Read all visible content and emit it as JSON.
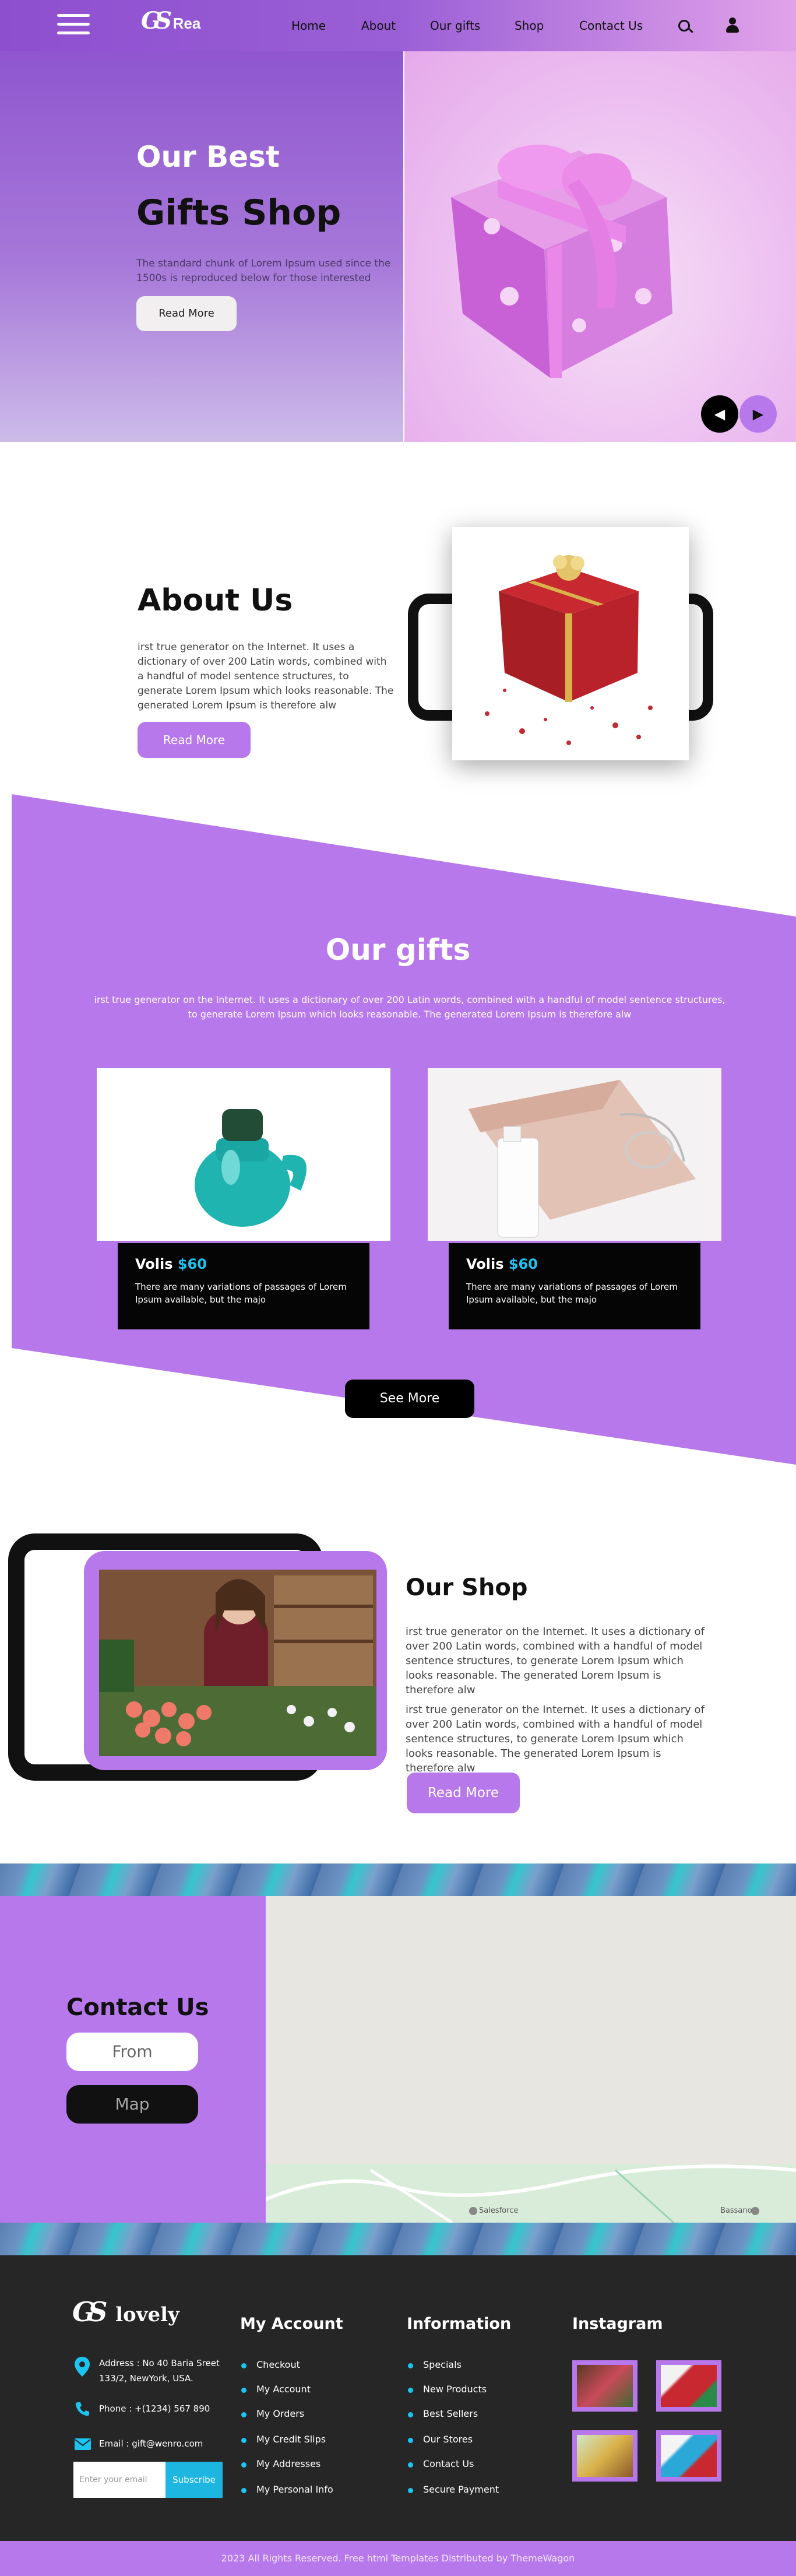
{
  "header": {
    "logo_mark": "GS",
    "logo_text": "Rea",
    "nav": [
      "Home",
      "About",
      "Our gifts",
      "Shop",
      "Contact Us"
    ],
    "icons": [
      "menu-icon",
      "search-icon",
      "user-icon"
    ]
  },
  "hero": {
    "title_line1": "Our Best",
    "title_line2": "Gifts Shop",
    "text": "The standard chunk of Lorem Ipsum used since the 1500s is reproduced below for those interested",
    "button": "Read More",
    "prev": "◀",
    "next": "▶"
  },
  "about": {
    "title": "About Us",
    "text": "irst true generator on the Internet. It uses a dictionary of over 200 Latin words, combined with a handful of model sentence structures, to generate Lorem Ipsum which looks reasonable. The generated Lorem Ipsum is therefore alw",
    "button": "Read More"
  },
  "gifts": {
    "title": "Our gifts",
    "text": "irst true generator on the Internet. It uses a dictionary of over 200 Latin words, combined with a handful of model sentence structures, to generate Lorem Ipsum which looks reasonable. The generated Lorem Ipsum is therefore alw",
    "cards": [
      {
        "name": "Volis",
        "price": "$60",
        "text": "There are many variations of passages of Lorem Ipsum available, but the majo"
      },
      {
        "name": "Volis",
        "price": "$60",
        "text": "There are many variations of passages of Lorem Ipsum available, but the majo"
      }
    ],
    "button": "See More"
  },
  "shop": {
    "title": "Our Shop",
    "paragraphs": [
      "irst true generator on the Internet. It uses a dictionary of over 200 Latin words, combined with a handful of model sentence structures, to generate Lorem Ipsum which looks reasonable. The generated Lorem Ipsum is therefore alw",
      "irst true generator on the Internet. It uses a dictionary of over 200 Latin words, combined with a handful of model sentence structures, to generate Lorem Ipsum which looks reasonable. The generated Lorem Ipsum is therefore alw"
    ],
    "button": "Read More"
  },
  "contact": {
    "title": "Contact Us",
    "from_button": "From",
    "map_button": "Map",
    "map_labels": [
      "Salesforce",
      "Bassano"
    ]
  },
  "footer": {
    "logo_mark": "GS",
    "logo_text": "lovely",
    "address": "Address : No 40 Baria Sreet 133/2, NewYork, USA.",
    "phone": "Phone : +(1234) 567 890",
    "email": "Email : gift@wenro.com",
    "subscribe_placeholder": "Enter your email",
    "subscribe_button": "Subscribe",
    "columns": [
      {
        "title": "My Account",
        "links": [
          "Checkout",
          "My Account",
          "My Orders",
          "My Credit Slips",
          "My Addresses",
          "My Personal Info"
        ]
      },
      {
        "title": "Information",
        "links": [
          "Specials",
          "New Products",
          "Best Sellers",
          "Our Stores",
          "Contact Us",
          "Secure Payment"
        ]
      }
    ],
    "instagram_title": "Instagram",
    "copyright": "2023 All Rights Reserved. Free html Templates Distributed by ThemeWagon"
  },
  "colors": {
    "accent": "#b778eb",
    "header_purple": "#8e4fcf",
    "price_blue": "#1cc4f2",
    "footer_dark": "#262626"
  }
}
